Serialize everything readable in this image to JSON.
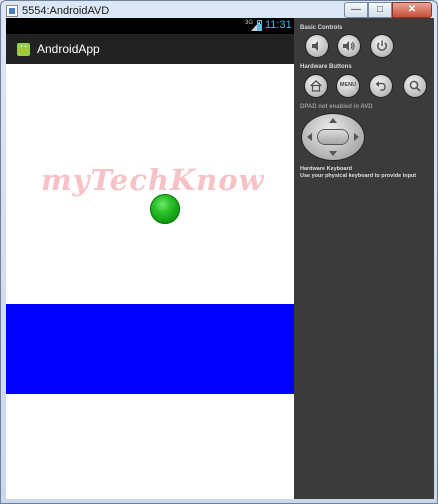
{
  "window": {
    "title": "5554:AndroidAVD",
    "minimize_label": "—",
    "maximize_label": "□",
    "close_label": "✕"
  },
  "status_bar": {
    "network_type": "3G",
    "time": "11:31"
  },
  "action_bar": {
    "app_title": "AndroidApp",
    "app_icon": "android-robot-icon"
  },
  "content": {
    "watermark": "myTechKnow",
    "ball_color": "#1db51d",
    "bar_color": "#0000ff"
  },
  "controls": {
    "basic_controls_label": "Basic Controls",
    "hardware_buttons_label": "Hardware Buttons",
    "menu_label": "MENU",
    "dpad_label": "DPAD not enabled in AVD",
    "keyboard_title": "Hardware Keyboard",
    "keyboard_hint": "Use your physical keyboard to provide input",
    "icons": [
      "volume-down-icon",
      "volume-up-icon",
      "power-icon",
      "home-icon",
      "menu-button",
      "back-icon",
      "search-icon",
      "dpad"
    ]
  }
}
